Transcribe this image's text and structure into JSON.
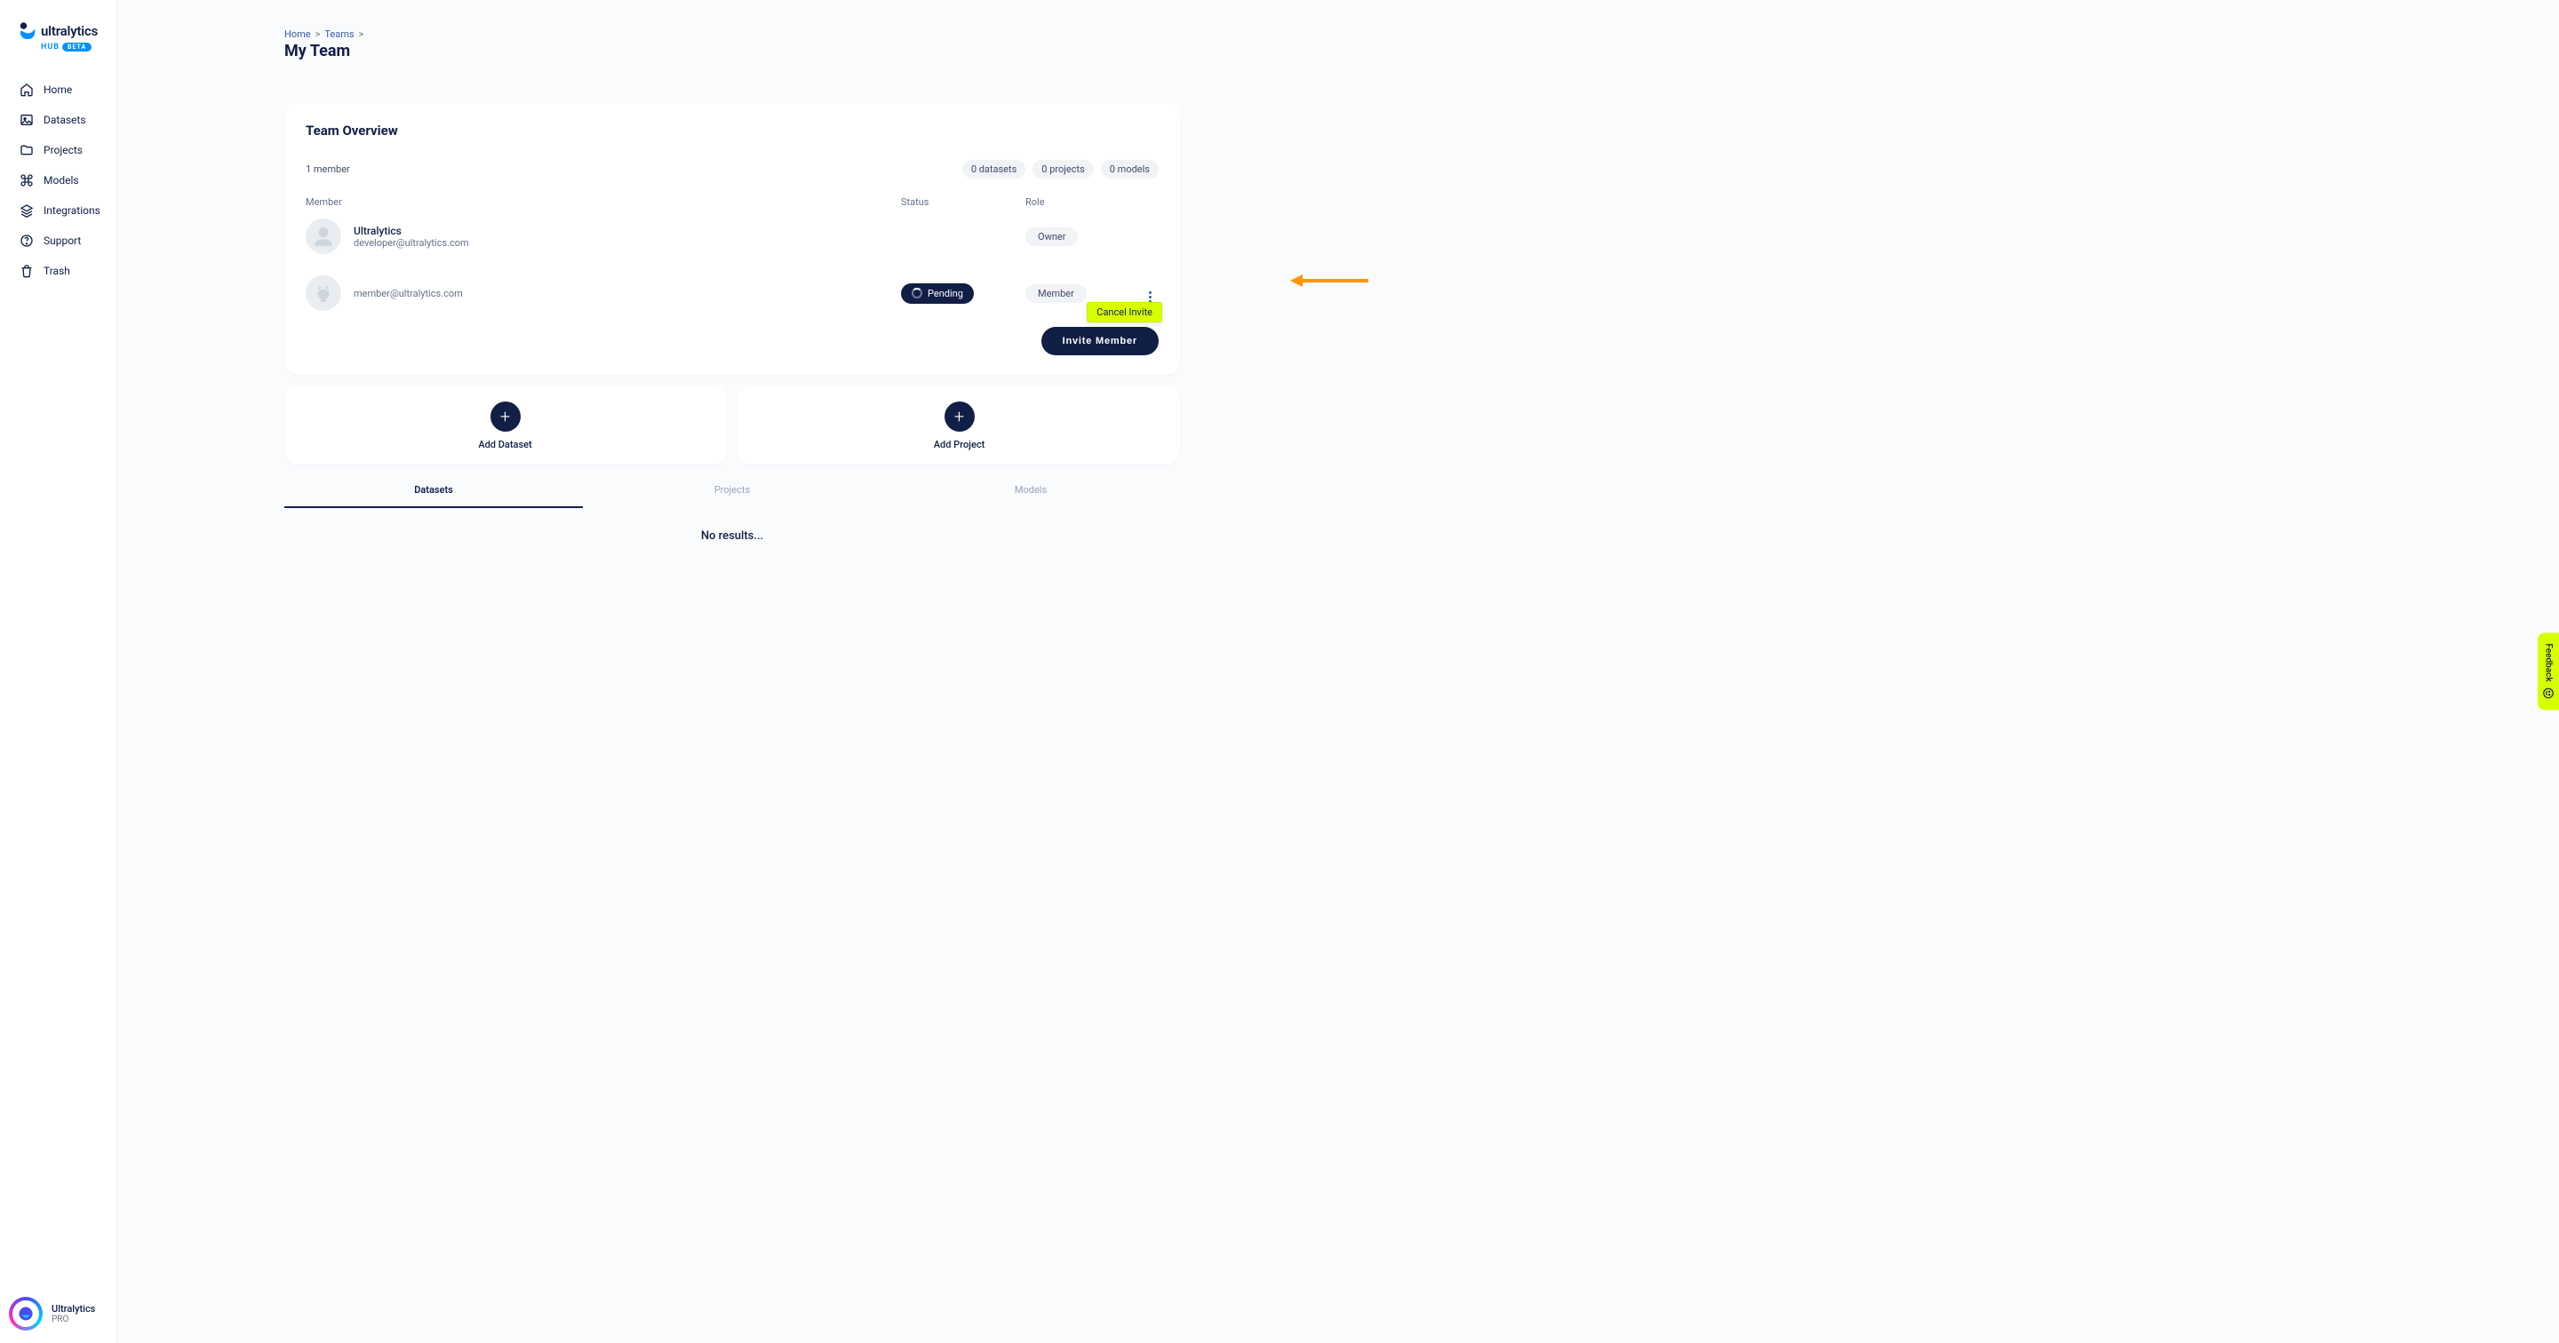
{
  "brand": {
    "name": "ultralytics",
    "sub": "HUB",
    "badge": "BETA"
  },
  "nav": {
    "home": "Home",
    "datasets": "Datasets",
    "projects": "Projects",
    "models": "Models",
    "integrations": "Integrations",
    "support": "Support",
    "trash": "Trash"
  },
  "user": {
    "name": "Ultralytics",
    "plan": "PRO"
  },
  "breadcrumb": {
    "home": "Home",
    "teams": "Teams"
  },
  "page_title": "My Team",
  "card": {
    "title": "Team Overview",
    "member_count": "1 member",
    "chips": {
      "datasets": "0 datasets",
      "projects": "0 projects",
      "models": "0 models"
    },
    "headers": {
      "member": "Member",
      "status": "Status",
      "role": "Role"
    }
  },
  "members": [
    {
      "name": "Ultralytics",
      "email": "developer@ultralytics.com",
      "status": "",
      "role": "Owner"
    },
    {
      "name": "",
      "email": "member@ultralytics.com",
      "status": "Pending",
      "role": "Member"
    }
  ],
  "dropdown": {
    "cancel_invite": "Cancel Invite"
  },
  "invite_button": "Invite Member",
  "add": {
    "dataset": "Add Dataset",
    "project": "Add Project"
  },
  "tabs": {
    "datasets": "Datasets",
    "projects": "Projects",
    "models": "Models"
  },
  "no_results": "No results...",
  "feedback": "Feedback"
}
